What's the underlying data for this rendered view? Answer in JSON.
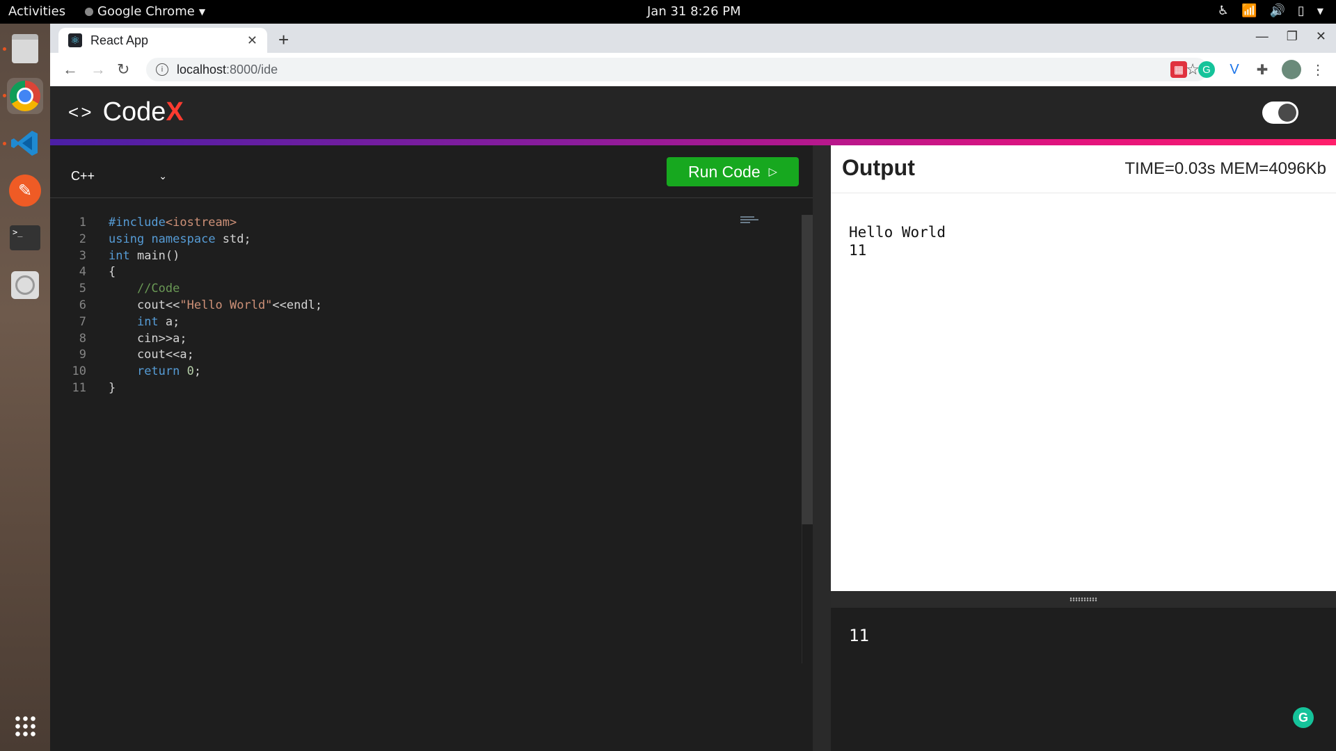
{
  "topbar": {
    "activities": "Activities",
    "app_name": "Google Chrome",
    "clock": "Jan 31  8:26 PM"
  },
  "browser": {
    "tab_title": "React App",
    "url_host": "localhost",
    "url_path": ":8000/ide"
  },
  "app": {
    "brand_main": "Code",
    "brand_accent": "X",
    "language": "C++",
    "run_label": "Run Code",
    "output_title": "Output",
    "output_stats": "TIME=0.03s MEM=4096Kb",
    "output_text": "Hello World\n11",
    "input_text": "11"
  },
  "code": {
    "line_numbers": [
      "1",
      "2",
      "3",
      "4",
      "5",
      "6",
      "7",
      "8",
      "9",
      "10",
      "11"
    ],
    "lines": [
      [
        {
          "t": "#include",
          "c": "kw"
        },
        {
          "t": "<iostream>",
          "c": "str"
        }
      ],
      [
        {
          "t": "using",
          "c": "kw"
        },
        {
          "t": " "
        },
        {
          "t": "namespace",
          "c": "kw"
        },
        {
          "t": " std;"
        }
      ],
      [
        {
          "t": "int",
          "c": "kw"
        },
        {
          "t": " main()"
        }
      ],
      [
        {
          "t": "{"
        }
      ],
      [
        {
          "t": "    "
        },
        {
          "t": "//Code",
          "c": "com"
        }
      ],
      [
        {
          "t": "    cout<<"
        },
        {
          "t": "\"Hello World\"",
          "c": "str"
        },
        {
          "t": "<<endl;"
        }
      ],
      [
        {
          "t": "    "
        },
        {
          "t": "int",
          "c": "kw"
        },
        {
          "t": " a;"
        }
      ],
      [
        {
          "t": "    cin>>a;"
        }
      ],
      [
        {
          "t": "    cout<<a;"
        }
      ],
      [
        {
          "t": "    "
        },
        {
          "t": "return",
          "c": "kw"
        },
        {
          "t": " "
        },
        {
          "t": "0",
          "c": "num"
        },
        {
          "t": ";"
        }
      ],
      [
        {
          "t": "}"
        }
      ]
    ]
  },
  "colors": {
    "run_button": "#17a81f",
    "brand_accent": "#ff3b30",
    "gradient_start": "#4b1fa6",
    "gradient_end": "#ff1f6b"
  }
}
